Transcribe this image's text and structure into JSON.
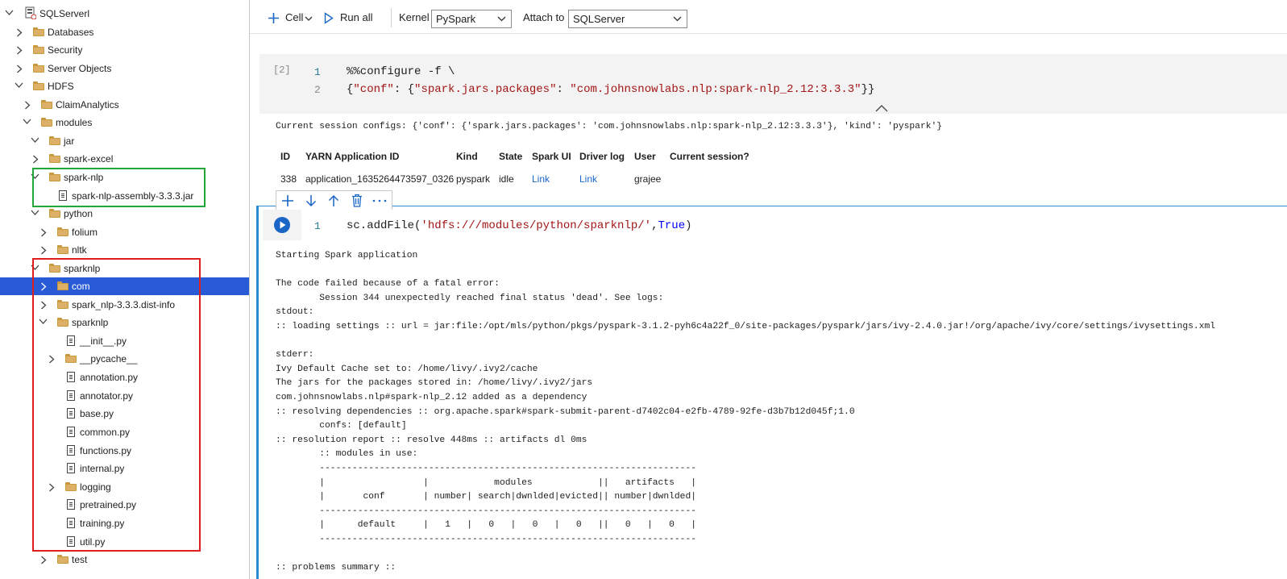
{
  "sidebar": {
    "server": "SQLServerl",
    "items": [
      {
        "label": "Databases",
        "type": "folder"
      },
      {
        "label": "Security",
        "type": "folder"
      },
      {
        "label": "Server Objects",
        "type": "folder"
      },
      {
        "label": "HDFS",
        "type": "folder"
      },
      {
        "label": "ClaimAnalytics",
        "type": "folder"
      },
      {
        "label": "modules",
        "type": "folder"
      },
      {
        "label": "jar",
        "type": "folder"
      },
      {
        "label": "spark-excel",
        "type": "folder"
      },
      {
        "label": "spark-nlp",
        "type": "folder"
      },
      {
        "label": "spark-nlp-assembly-3.3.3.jar",
        "type": "file"
      },
      {
        "label": "python",
        "type": "folder"
      },
      {
        "label": "folium",
        "type": "folder"
      },
      {
        "label": "nltk",
        "type": "folder"
      },
      {
        "label": "sparknlp",
        "type": "folder"
      },
      {
        "label": "com",
        "type": "folder"
      },
      {
        "label": "spark_nlp-3.3.3.dist-info",
        "type": "folder"
      },
      {
        "label": "sparknlp",
        "type": "folder"
      },
      {
        "label": "__init__.py",
        "type": "file"
      },
      {
        "label": "__pycache__",
        "type": "folder"
      },
      {
        "label": "annotation.py",
        "type": "file"
      },
      {
        "label": "annotator.py",
        "type": "file"
      },
      {
        "label": "base.py",
        "type": "file"
      },
      {
        "label": "common.py",
        "type": "file"
      },
      {
        "label": "functions.py",
        "type": "file"
      },
      {
        "label": "internal.py",
        "type": "file"
      },
      {
        "label": "logging",
        "type": "folder"
      },
      {
        "label": "pretrained.py",
        "type": "file"
      },
      {
        "label": "training.py",
        "type": "file"
      },
      {
        "label": "util.py",
        "type": "file"
      },
      {
        "label": "test",
        "type": "folder"
      }
    ],
    "highlight_colors": {
      "green": "#22a63a",
      "red": "#e01e1e"
    },
    "selected_color": "#2a5bd7"
  },
  "toolbar": {
    "cell_label": "Cell",
    "run_all_label": "Run all",
    "kernel_label": "Kernel",
    "kernel_value": "PySpark",
    "attach_label": "Attach to",
    "attach_value": "SQLServer"
  },
  "cell1": {
    "exec_count": "[2]",
    "line1_no": "1",
    "line2_no": "2",
    "line1": "%%configure -f \\",
    "line2_a": "{",
    "line2_b": "\"conf\"",
    "line2_c": ": {",
    "line2_d": "\"spark.jars.packages\"",
    "line2_e": ": ",
    "line2_f": "\"com.johnsnowlabs.nlp:spark-nlp_2.12:3.3.3\"",
    "line2_g": "}}"
  },
  "session": {
    "configs_text": "Current session configs: {'conf': {'spark.jars.packages': 'com.johnsnowlabs.nlp:spark-nlp_2.12:3.3.3'}, 'kind': 'pyspark'}",
    "headers": [
      "ID",
      "YARN Application ID",
      "Kind",
      "State",
      "Spark UI",
      "Driver log",
      "User",
      "Current session?"
    ],
    "row": {
      "id": "338",
      "app_id": "application_1635264473597_0326",
      "kind": "pyspark",
      "state": "idle",
      "spark_ui": "Link",
      "driver_log": "Link",
      "user": "grajee",
      "current": ""
    }
  },
  "cell2": {
    "line_no": "1",
    "code_a": "sc.addFile(",
    "code_b": "'hdfs:///modules/python/sparknlp/'",
    "code_c": ",",
    "code_d": "True",
    "code_e": ")"
  },
  "output": {
    "lines": [
      "Starting Spark application",
      "",
      "The code failed because of a fatal error:",
      "        Session 344 unexpectedly reached final status 'dead'. See logs:",
      "stdout:",
      ":: loading settings :: url = jar:file:/opt/mls/python/pkgs/pyspark-3.1.2-pyh6c4a22f_0/site-packages/pyspark/jars/ivy-2.4.0.jar!/org/apache/ivy/core/settings/ivysettings.xml",
      "",
      "stderr:",
      "Ivy Default Cache set to: /home/livy/.ivy2/cache",
      "The jars for the packages stored in: /home/livy/.ivy2/jars",
      "com.johnsnowlabs.nlp#spark-nlp_2.12 added as a dependency",
      ":: resolving dependencies :: org.apache.spark#spark-submit-parent-d7402c04-e2fb-4789-92fe-d3b7b12d045f;1.0",
      "        confs: [default]",
      ":: resolution report :: resolve 448ms :: artifacts dl 0ms",
      "        :: modules in use:",
      "        ---------------------------------------------------------------------",
      "        |                  |            modules            ||   artifacts   |",
      "        |       conf       | number| search|dwnlded|evicted|| number|dwnlded|",
      "        ---------------------------------------------------------------------",
      "        |      default     |   1   |   0   |   0   |   0   ||   0   |   0   |",
      "        ---------------------------------------------------------------------",
      "",
      ":: problems summary ::"
    ]
  }
}
